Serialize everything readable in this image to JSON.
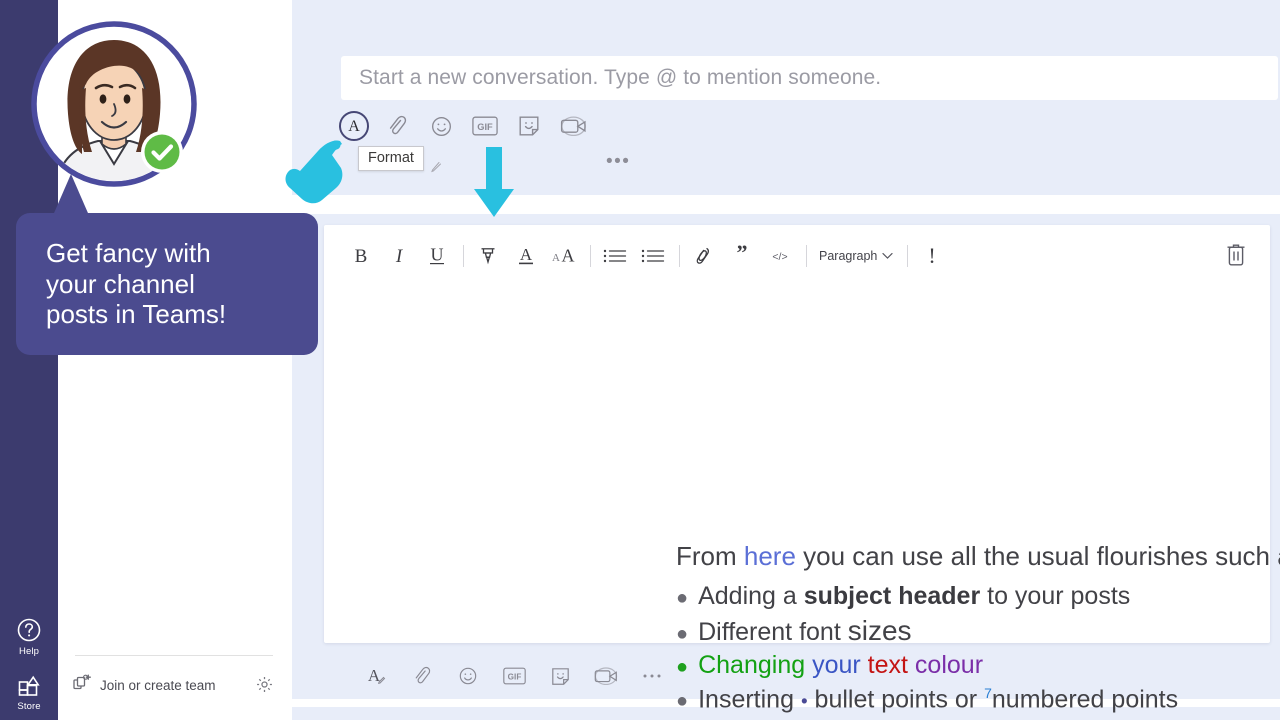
{
  "colors": {
    "rail_bg": "#3c3b6e",
    "pane_bg": "#e8edf9",
    "accent_purple": "#464775",
    "callout_bg": "#4b4b8f",
    "annotation_cyan": "#29c0e0",
    "presence_green": "#5fbb46",
    "link_blue": "#5b6fd6"
  },
  "app_rail": {
    "items": [
      {
        "label": "Help",
        "icon": "help-question-icon"
      },
      {
        "label": "Store",
        "icon": "store-icon"
      }
    ]
  },
  "teams_sidebar": {
    "join_or_create": {
      "label": "Join or create team",
      "icon": "add-team-icon"
    },
    "settings_icon": "gear-icon"
  },
  "avatar": {
    "name": "user-avatar",
    "presence": "available",
    "presence_icon": "checkmark-icon"
  },
  "new_conversation": {
    "placeholder": "Start a new conversation. Type @ to mention someone."
  },
  "composer_top": {
    "icons": [
      {
        "name": "format-icon",
        "glyph": "A",
        "active": true
      },
      {
        "name": "attach-icon",
        "glyph": "paperclip"
      },
      {
        "name": "emoji-icon",
        "glyph": "smiley"
      },
      {
        "name": "giphy-icon",
        "glyph": "GIF"
      },
      {
        "name": "sticker-icon",
        "glyph": "sticker"
      },
      {
        "name": "meet-now-icon",
        "glyph": "video-camera"
      }
    ],
    "more_label": "•••",
    "tooltip": "Format"
  },
  "format_toolbar": {
    "buttons": [
      {
        "name": "bold-button",
        "label": "B"
      },
      {
        "name": "italic-button",
        "label": "I"
      },
      {
        "name": "underline-button",
        "label": "U"
      },
      {
        "name": "highlight-button",
        "label": "highlighter-icon"
      },
      {
        "name": "font-color-button",
        "label": "A"
      },
      {
        "name": "font-size-button",
        "label": "AA"
      },
      {
        "name": "bulleted-list-button",
        "label": "bullet-list-icon"
      },
      {
        "name": "numbered-list-button",
        "label": "numbered-list-icon"
      },
      {
        "name": "insert-link-button",
        "label": "link-icon"
      },
      {
        "name": "quote-button",
        "label": "quote-icon"
      },
      {
        "name": "code-snippet-button",
        "label": "code-icon"
      }
    ],
    "paragraph_label": "Paragraph",
    "important_label": "!",
    "delete_icon": "trash-icon"
  },
  "message_body": {
    "lead": {
      "before": "From ",
      "link": "here",
      "after": " you can use all the usual flourishes such as:"
    },
    "bullets": [
      {
        "dot_color": "grey",
        "parts": [
          {
            "text": "Adding a ",
            "style": "normal"
          },
          {
            "text": "subject header",
            "style": "bold"
          },
          {
            "text": " to your posts",
            "style": "normal"
          }
        ]
      },
      {
        "dot_color": "grey",
        "parts": [
          {
            "text": "Different font ",
            "style": "normal"
          },
          {
            "text": "sizes",
            "style": "large"
          }
        ]
      },
      {
        "dot_color": "green",
        "parts": [
          {
            "text": "Changing ",
            "style": "green"
          },
          {
            "text": "your ",
            "style": "blue"
          },
          {
            "text": "text ",
            "style": "red"
          },
          {
            "text": "colour",
            "style": "purple"
          }
        ]
      },
      {
        "dot_color": "grey",
        "parts": [
          {
            "text": "Inserting ",
            "style": "normal"
          },
          {
            "text": "•",
            "style": "inline-bullet"
          },
          {
            "text": " bullet points or ",
            "style": "normal"
          },
          {
            "text": "7",
            "style": "superscript"
          },
          {
            "text": "numbered points",
            "style": "normal"
          }
        ]
      }
    ]
  },
  "composer_bottom": {
    "icons": [
      {
        "name": "format-icon",
        "glyph": "A"
      },
      {
        "name": "attach-icon",
        "glyph": "paperclip"
      },
      {
        "name": "emoji-icon",
        "glyph": "smiley"
      },
      {
        "name": "giphy-icon",
        "glyph": "GIF"
      },
      {
        "name": "sticker-icon",
        "glyph": "sticker"
      },
      {
        "name": "meet-now-icon",
        "glyph": "video-camera"
      },
      {
        "name": "more-options-icon",
        "glyph": "•••"
      }
    ]
  },
  "callout": {
    "text": "Get fancy with\nyour channel\nposts in Teams!"
  },
  "annotations": {
    "hand_cursor": "pointing-hand-cursor",
    "down_arrow": "down-arrow"
  }
}
